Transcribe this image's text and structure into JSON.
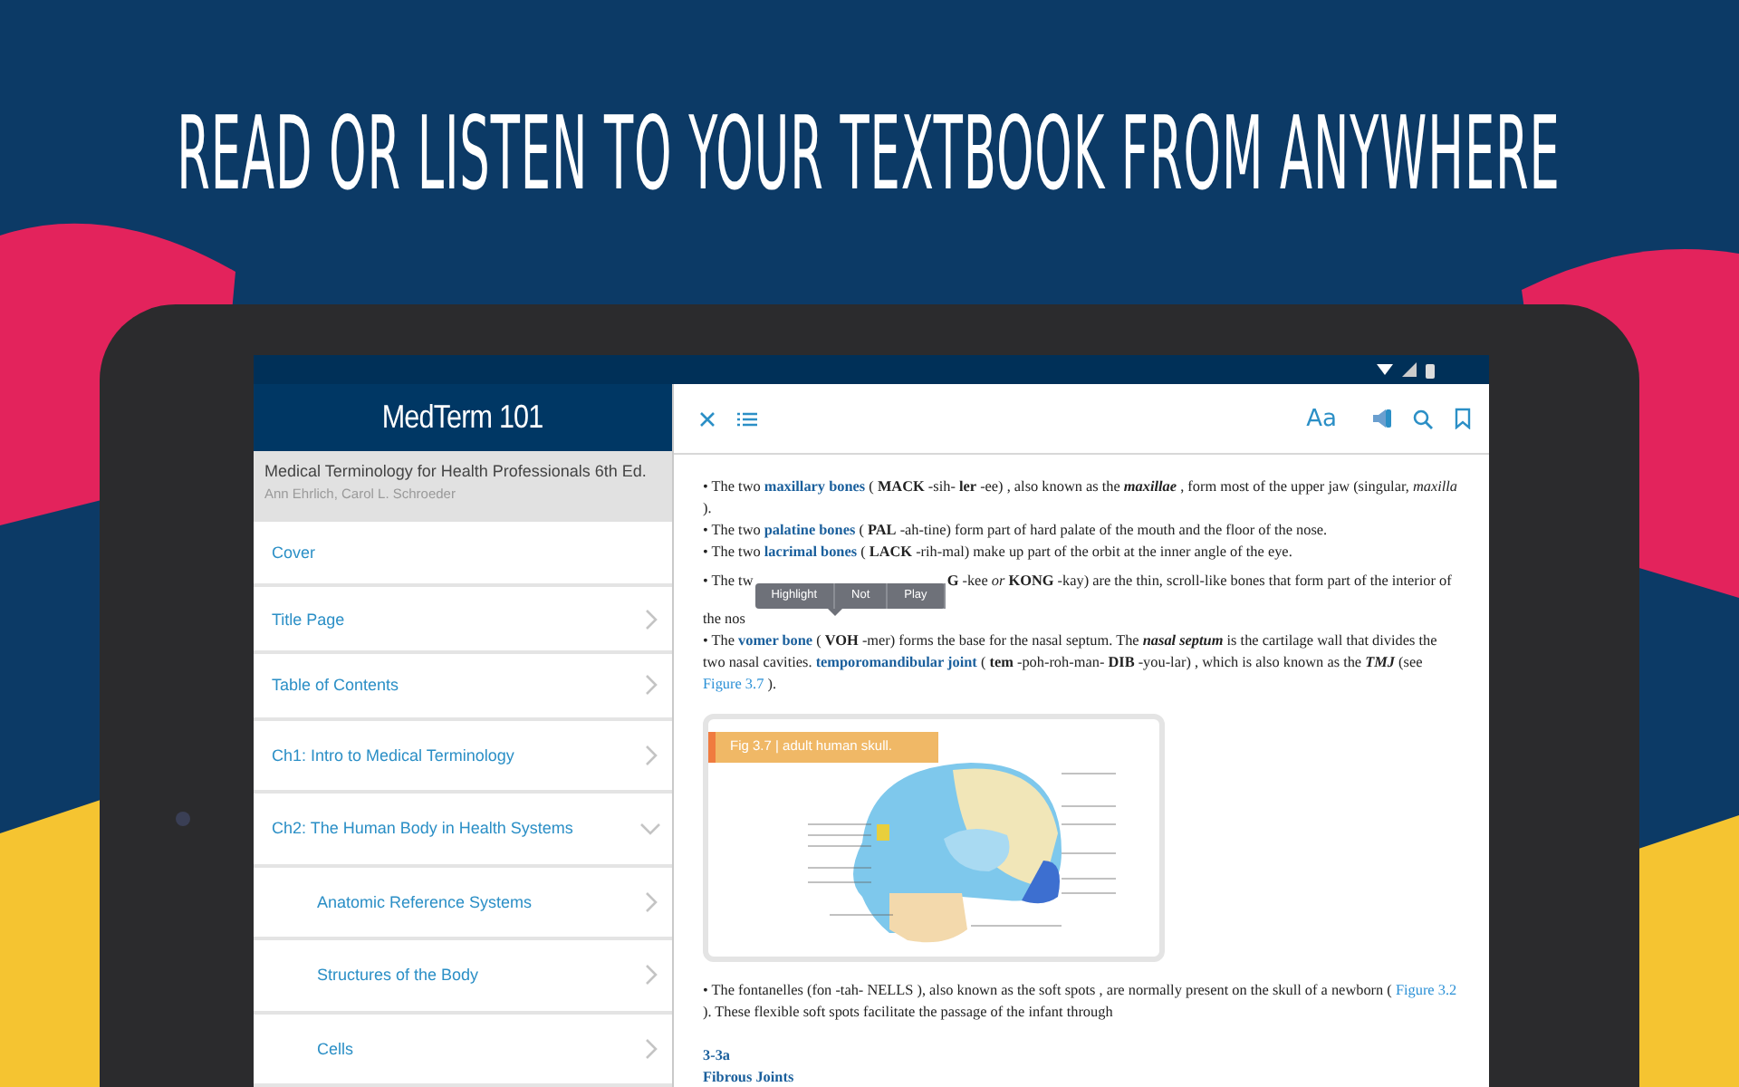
{
  "headline": "READ OR LISTEN TO YOUR TEXTBOOK FROM ANYWHERE",
  "sidebar": {
    "title": "MedTerm 101",
    "book_title": "Medical Terminology for Health Professionals 6th Ed.",
    "book_authors": "Ann Ehrlich, Carol L. Schroeder",
    "items": [
      {
        "label": "Cover",
        "kind": "plain"
      },
      {
        "label": "Title Page",
        "kind": "nav",
        "expanded": false
      },
      {
        "label": "Table of Contents",
        "kind": "nav",
        "expanded": false
      },
      {
        "label": "Ch1: Intro to Medical Terminology",
        "kind": "nav",
        "expanded": false
      },
      {
        "label": "Ch2: The Human Body in Health Systems",
        "kind": "nav",
        "expanded": true,
        "children": [
          {
            "label": "Anatomic Reference Systems",
            "kind": "nav",
            "expanded": false
          },
          {
            "label": "Structures of the Body",
            "kind": "nav",
            "expanded": false
          },
          {
            "label": "Cells",
            "kind": "nav",
            "expanded": false
          }
        ]
      }
    ]
  },
  "reader": {
    "font_button": "Aa",
    "blocks": [
      {
        "kind": "paragraph",
        "segments": [
          {
            "kind": "plain",
            "text": "• The two "
          },
          {
            "kind": "term",
            "text": "maxillary bones"
          },
          {
            "kind": "plain",
            "text": " ( **MACK** -sih- **ler** -ee) , also known as the "
          },
          {
            "kind": "keyword",
            "text": "maxillae"
          },
          {
            "kind": "plain",
            "text": " , form most of the upper jaw (singular, *maxilla* )."
          }
        ]
      },
      {
        "kind": "paragraph",
        "segments": [
          {
            "kind": "plain",
            "text": "• The two "
          },
          {
            "kind": "term",
            "text": "palatine bones"
          },
          {
            "kind": "plain",
            "text": " ( **PAL** -ah-tine) form part of  hard palate of the mouth and the floor of the nose."
          }
        ]
      },
      {
        "kind": "paragraph",
        "segments": [
          {
            "kind": "plain",
            "text": "• The two "
          },
          {
            "kind": "term",
            "text": "lacrimal bones"
          },
          {
            "kind": "plain",
            "text": " ( **LACK** -rih-mal) make up part of the orbit at the inner angle of the eye."
          }
        ]
      },
      {
        "kind": "paragraph",
        "segments": [
          {
            "kind": "plain",
            "text": "• The tw"
          },
          {
            "kind": "popup",
            "buttons": [
              "Highlight",
              "Not",
              "Play"
            ]
          },
          {
            "kind": "plain",
            "text": "**G** -kee *or* **KONG** -kay) are the thin, scroll-like bones that form part of the interior of the nos"
          }
        ]
      },
      {
        "kind": "paragraph",
        "segments": [
          {
            "kind": "plain",
            "text": "• The "
          },
          {
            "kind": "term",
            "text": "vomer bone"
          },
          {
            "kind": "plain",
            "text": " ( **VOH** -mer) forms the base for the nasal septum. The "
          },
          {
            "kind": "keyword",
            "text": "nasal septum"
          },
          {
            "kind": "plain",
            "text": " is the cartilage wall that divides the two nasal cavities. "
          },
          {
            "kind": "term",
            "text": "temporomandibular joint"
          },
          {
            "kind": "plain",
            "text": " ( **tem** -poh-roh-man- **DIB** -you-lar) , which is also known as the "
          },
          {
            "kind": "keyword",
            "text": "TMJ"
          },
          {
            "kind": "plain",
            "text": " (see "
          },
          {
            "kind": "link",
            "text": "Figure 3.7"
          },
          {
            "kind": "plain",
            "text": " )."
          }
        ]
      },
      {
        "kind": "figure",
        "caption": "Fig 3.7 | adult human skull."
      },
      {
        "kind": "paragraph",
        "segments": [
          {
            "kind": "plain",
            "text": "• The fontanelles (fon -tah- NELLS ), also known as the soft spots , are normally present on the skull of a newborn ( "
          },
          {
            "kind": "link",
            "text": "Figure 3.2"
          },
          {
            "kind": "plain",
            "text": " ). These flexible soft spots facilitate the passage of the infant through"
          }
        ]
      },
      {
        "kind": "heading",
        "number": "3-3a",
        "title": "Fibrous Joints"
      }
    ]
  }
}
